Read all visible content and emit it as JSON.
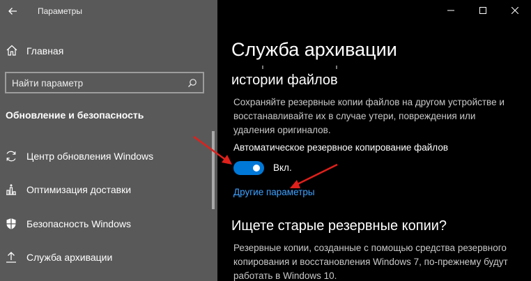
{
  "window": {
    "app_title": "Параметры",
    "minimize": "—",
    "maximize": "☐",
    "close": "✕"
  },
  "sidebar": {
    "home_label": "Главная",
    "search_placeholder": "Найти параметр",
    "section_header": "Обновление и безопасность",
    "items": [
      {
        "label": "Центр обновления Windows",
        "icon": "refresh-icon"
      },
      {
        "label": "Оптимизация доставки",
        "icon": "delivery-optimization-icon"
      },
      {
        "label": "Безопасность Windows",
        "icon": "shield-icon"
      },
      {
        "label": "Служба архивации",
        "icon": "upload-icon"
      }
    ]
  },
  "content": {
    "title": "Служба архивации",
    "subtitle": "истории файлов",
    "description": "Сохраняйте резервные копии файлов на другом устройстве и восстанавливайте их в случае утери, повреждения или удаления оригиналов.",
    "toggle_heading": "Автоматическое резервное копирование файлов",
    "toggle_state": "Вкл.",
    "toggle_on": true,
    "more_options": "Другие параметры",
    "section2_title": "Ищете старые резервные копии?",
    "section2_text": "Резервные копии, созданные с помощью средства резервного копирования и восстановления Windows 7, по-прежнему будут работать в Windows 10."
  },
  "colors": {
    "sidebar_bg": "#595959",
    "content_bg": "#000000",
    "accent": "#0078d7",
    "link": "#3ea1ff",
    "annotation": "#e0201b"
  }
}
